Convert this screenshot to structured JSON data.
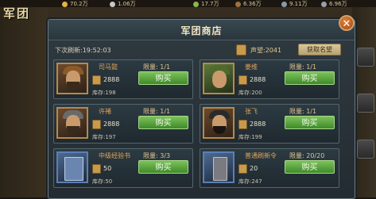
{
  "top_bar": {
    "resources": [
      {
        "icon": "gold-icon",
        "value": "70.2万"
      },
      {
        "icon": "silver-icon",
        "value": "1.06万"
      },
      {
        "icon": "food-icon",
        "value": "17.7万"
      },
      {
        "icon": "wood-icon",
        "value": "6.36万"
      },
      {
        "icon": "iron-icon",
        "value": "9.11万"
      },
      {
        "icon": "stone-icon",
        "value": "6.96万"
      }
    ]
  },
  "corner_title": "军团",
  "shop": {
    "title": "军团商店",
    "next_refresh": "下次刷新:19:52:03",
    "fame_label": "声望",
    "fame_value": "2041",
    "fame_text": "声望:2041",
    "get_fame_label": "获取名望",
    "items": [
      {
        "name": "司马懿",
        "limit": "限量: 1/1",
        "price": "2888",
        "stock": "库存:198",
        "buy_label": "购买"
      },
      {
        "name": "姜维",
        "limit": "限量: 1/1",
        "price": "2888",
        "stock": "库存:200",
        "buy_label": "购买"
      },
      {
        "name": "许褚",
        "limit": "限量: 1/1",
        "price": "2888",
        "stock": "库存:197",
        "buy_label": "购买"
      },
      {
        "name": "张飞",
        "limit": "限量: 1/1",
        "price": "2888",
        "stock": "库存:199",
        "buy_label": "购买"
      },
      {
        "name": "中级经验书",
        "limit": "限量: 3/3",
        "price": "50",
        "stock": "库存:50",
        "buy_label": "购买"
      },
      {
        "name": "普通刷新令",
        "limit": "限量: 20/20",
        "price": "20",
        "stock": "库存:247",
        "buy_label": "购买"
      }
    ]
  },
  "colors": {
    "accent_green": "#5aa83a",
    "title_gold": "#e0a45a",
    "panel": "#2a363d"
  }
}
